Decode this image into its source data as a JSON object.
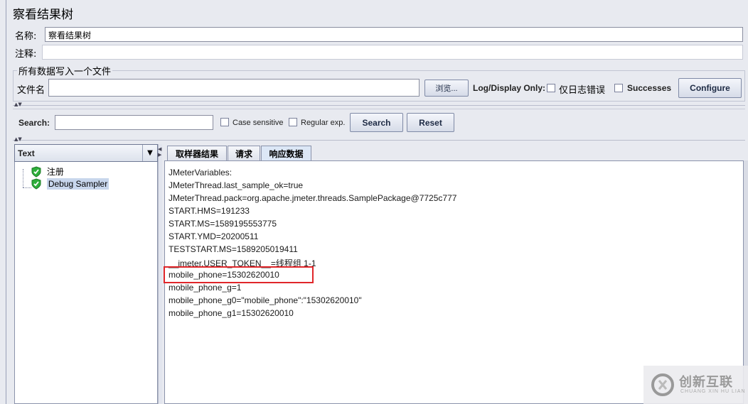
{
  "title": "察看结果树",
  "name_label": "名称:",
  "name_value": "察看结果树",
  "comment_label": "注释:",
  "file_section": "所有数据写入一个文件",
  "filename_label": "文件名",
  "browse_label": "浏览...",
  "log_display_label": "Log/Display Only:",
  "errors_only_label": "仅日志错误",
  "successes_label": "Successes",
  "configure_label": "Configure",
  "search_label": "Search:",
  "case_sensitive_label": "Case sensitive",
  "regular_exp_label": "Regular exp.",
  "search_button": "Search",
  "reset_button": "Reset",
  "renderer_value": "Text",
  "tree_items": [
    "注册",
    "Debug Sampler"
  ],
  "tabs": [
    "取样器结果",
    "请求",
    "响应数据"
  ],
  "response_lines": [
    "JMeterVariables:",
    "JMeterThread.last_sample_ok=true",
    "JMeterThread.pack=org.apache.jmeter.threads.SamplePackage@7725c777",
    "START.HMS=191233",
    "START.MS=1589195553775",
    "START.YMD=20200511",
    "TESTSTART.MS=1589205019411",
    "__jmeter.USER_TOKEN__=线程组 1-1",
    "mobile_phone=15302620010",
    "mobile_phone_g=1",
    "mobile_phone_g0=\"mobile_phone\":\"15302620010\"",
    "mobile_phone_g1=15302620010"
  ],
  "highlight_color": "#e0262a",
  "watermark_text": "创新互联",
  "watermark_sub": "CHUANG XIN HU LIAN"
}
